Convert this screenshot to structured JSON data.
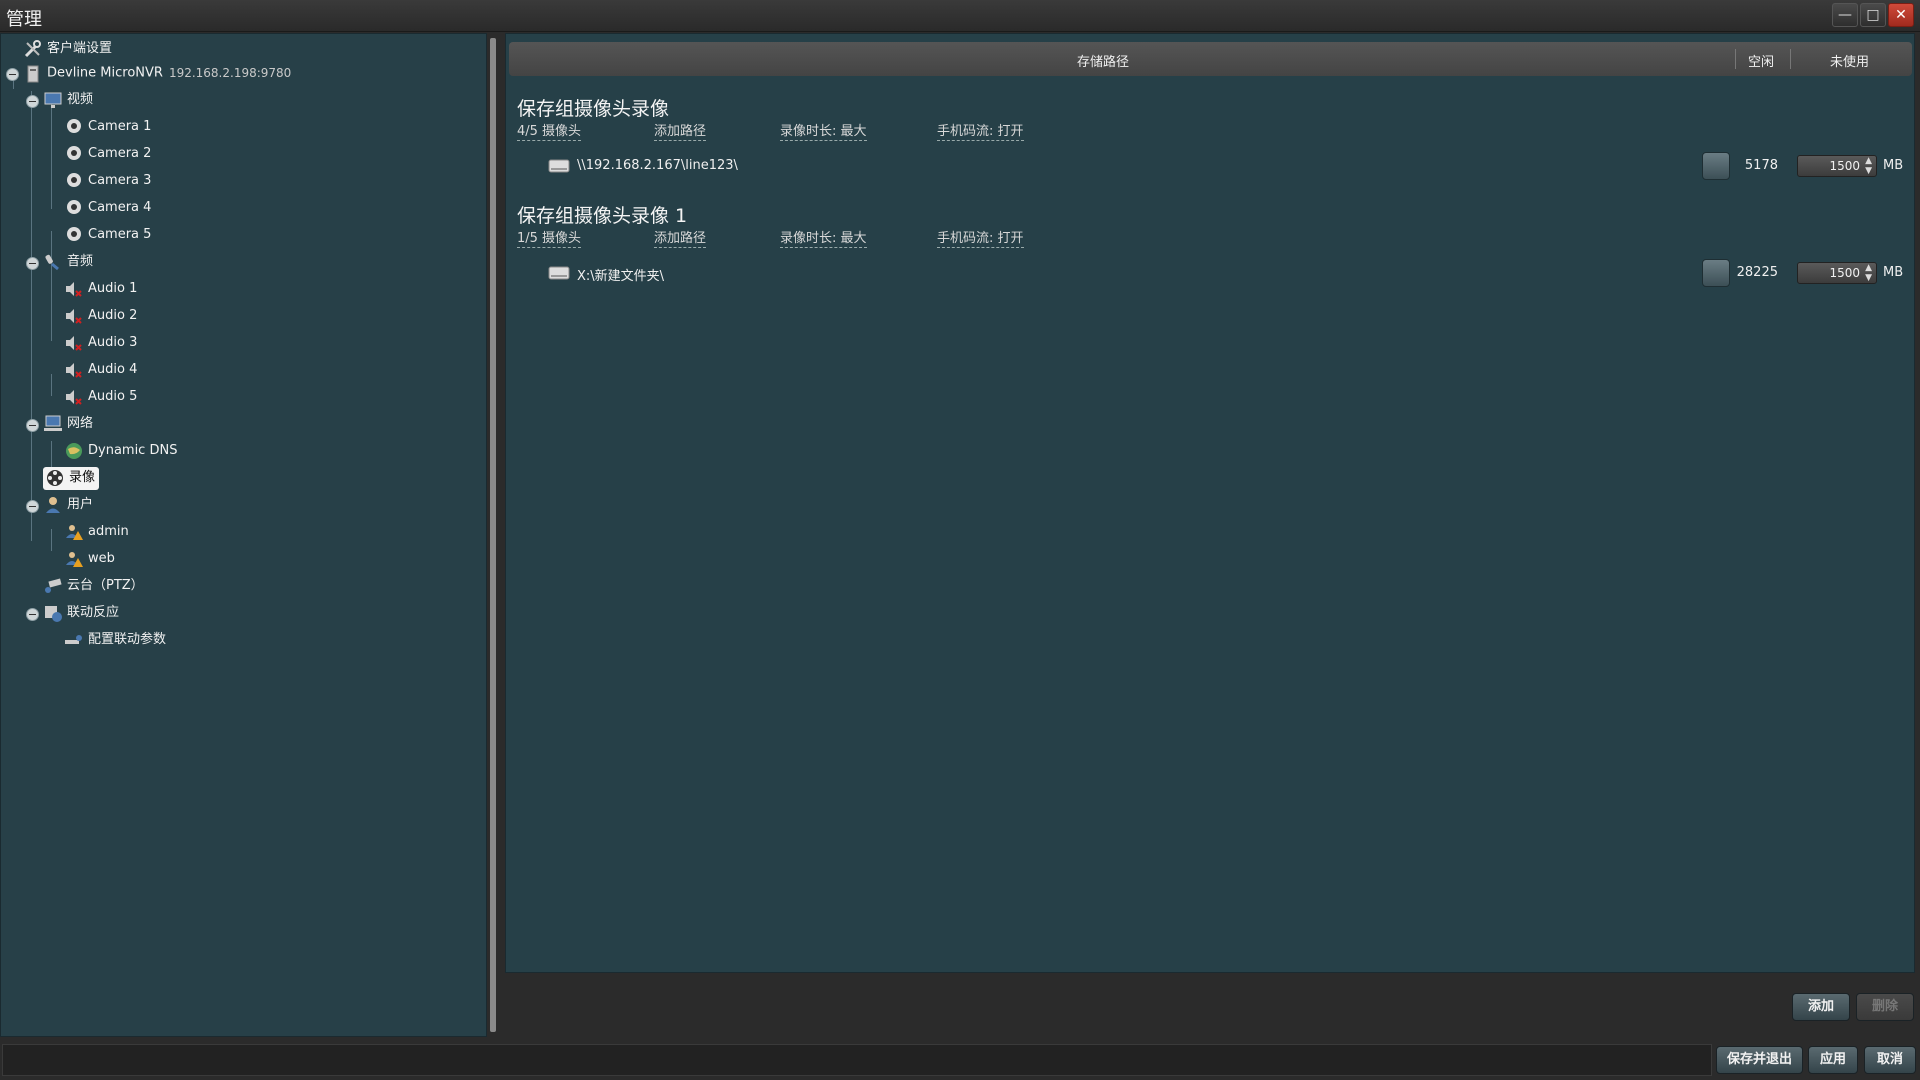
{
  "window": {
    "title": "管理"
  },
  "tree": {
    "client_settings": "客户端设置",
    "server": {
      "name": "Devline MicroNVR",
      "address": "192.168.2.198:9780"
    },
    "video": {
      "label": "视频",
      "cameras": [
        "Camera 1",
        "Camera 2",
        "Camera 3",
        "Camera 4",
        "Camera 5"
      ]
    },
    "audio": {
      "label": "音频",
      "items": [
        "Audio 1",
        "Audio 2",
        "Audio 3",
        "Audio 4",
        "Audio 5"
      ]
    },
    "network": {
      "label": "网络",
      "items": [
        "Dynamic DNS"
      ]
    },
    "recording": {
      "label": "录像"
    },
    "users": {
      "label": "用户",
      "items": [
        "admin",
        "web"
      ]
    },
    "ptz": {
      "label": "云台（PTZ）"
    },
    "linkage": {
      "label": "联动反应",
      "items": [
        "配置联动参数"
      ]
    }
  },
  "header": {
    "path": "存储路径",
    "free": "空闲",
    "unused": "未使用"
  },
  "groups": [
    {
      "title": "保存组摄像头录像",
      "cameras": "4/5 摄像头",
      "add_path": "添加路径",
      "duration": "录像时长: 最大",
      "mobile": "手机码流: 打开",
      "path": "\\\\192.168.2.167\\line123\\",
      "free": "5178",
      "size": "1500",
      "unit": "MB"
    },
    {
      "title": "保存组摄像头录像 1",
      "cameras": "1/5 摄像头",
      "add_path": "添加路径",
      "duration": "录像时长: 最大",
      "mobile": "手机码流: 打开",
      "path": "X:\\新建文件夹\\",
      "free": "28225",
      "size": "1500",
      "unit": "MB"
    }
  ],
  "actions": {
    "add": "添加",
    "delete": "删除"
  },
  "footer": {
    "save_exit": "保存并退出",
    "apply": "应用",
    "cancel": "取消"
  },
  "colors": {
    "panel": "#274048",
    "warning": "#e8a020",
    "error": "#d02020"
  }
}
